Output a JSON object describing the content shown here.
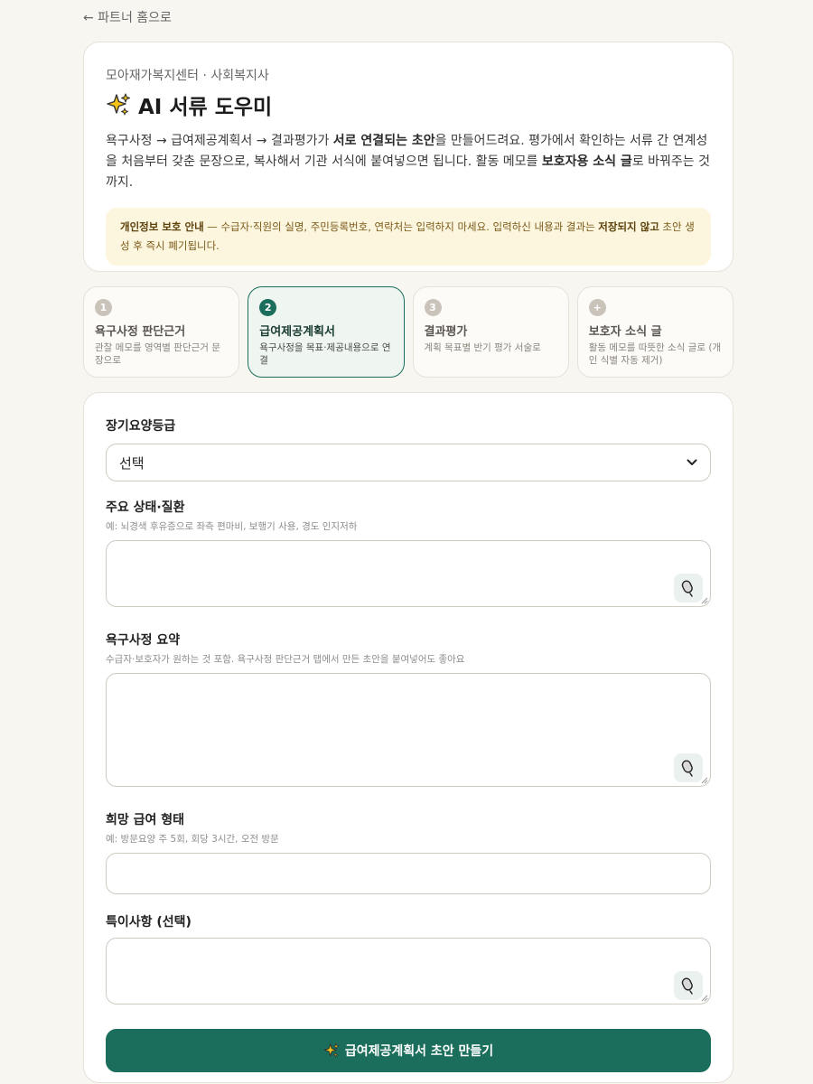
{
  "nav": {
    "back_label": "← 파트너 홈으로"
  },
  "intro": {
    "org": "모아재가복지센터 · 사회복지사",
    "title": "AI 서류 도우미",
    "desc": {
      "p1": "욕구사정 → 급여제공계획서 → 결과평가가 ",
      "b1": "서로 연결되는 초안",
      "p2": "을 만들어드려요. 평가에서 확인하는 서류 간 연계성을 처음부터 갖춘 문장으로, 복사해서 기관 서식에 붙여넣으면 됩니다. 활동 메모를 ",
      "b2": "보호자용 소식 글",
      "p3": "로 바꿔주는 것까지."
    },
    "notice": {
      "b1": "개인정보 보호 안내",
      "p1": " — 수급자·직원의 실명, 주민등록번호, 연락처는 입력하지 마세요. 입력하신 내용과 결과는 ",
      "b2": "저장되지 않고",
      "p2": " 초안 생성 후 즉시 폐기됩니다."
    }
  },
  "steps": [
    {
      "num": "1",
      "title": "욕구사정 판단근거",
      "sub": "관찰 메모를 영역별 판단근거 문장으로"
    },
    {
      "num": "2",
      "title": "급여제공계획서",
      "sub": "욕구사정을 목표·제공내용으로 연결"
    },
    {
      "num": "3",
      "title": "결과평가",
      "sub": "계획 목표별 반기 평가 서술로"
    },
    {
      "num": "+",
      "title": "보호자 소식 글",
      "sub": "활동 메모를 따뜻한 소식 글로 (개인 식별 자동 제거)"
    }
  ],
  "form": {
    "grade": {
      "label": "장기요양등급",
      "value": "선택"
    },
    "condition": {
      "label": "주요 상태·질환",
      "hint": "예: 뇌경색 후유증으로 좌측 편마비, 보행기 사용, 경도 인지저하"
    },
    "needs": {
      "label": "욕구사정 요약",
      "hint": "수급자·보호자가 원하는 것 포함. 욕구사정 판단근거 탭에서 만든 초안을 붙여넣어도 좋아요"
    },
    "service": {
      "label": "희망 급여 형태",
      "hint": "예: 방문요양 주 5회, 회당 3시간, 오전 방문"
    },
    "notes": {
      "label": "특이사항 (선택)"
    },
    "submit_label": "급여제공계획서 초안 만들기"
  },
  "colors": {
    "accent": "#1a6e5b",
    "notice_bg": "#fdf6df",
    "background": "#f8f6f1"
  }
}
